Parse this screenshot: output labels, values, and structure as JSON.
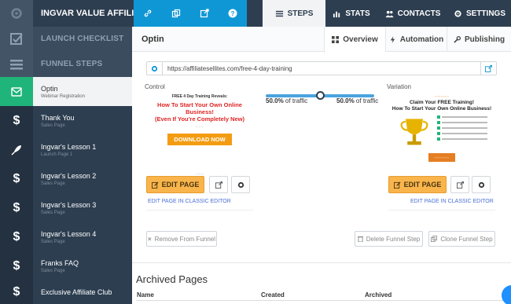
{
  "topbar": {
    "funnel_title": "INGVAR VALUE AFFILIAT...",
    "tabs": [
      {
        "label": "STEPS",
        "icon": "menu-icon"
      },
      {
        "label": "STATS",
        "icon": "bar-chart-icon"
      },
      {
        "label": "CONTACTS",
        "icon": "users-icon"
      },
      {
        "label": "SETTINGS",
        "icon": "gear-icon"
      }
    ],
    "active_tab": "STEPS"
  },
  "sidebar": {
    "launch_checklist": "LAUNCH CHECKLIST",
    "funnel_steps": "FUNNEL STEPS",
    "steps": [
      {
        "title": "Optin",
        "subtitle": "Webinar Registration",
        "icon": "envelope-icon",
        "active": true
      },
      {
        "title": "Thank You",
        "subtitle": "Sales Page",
        "icon": "dollar-icon"
      },
      {
        "title": "Ingvar's Lesson 1",
        "subtitle": "Launch Page 1",
        "icon": "rocket-icon"
      },
      {
        "title": "Ingvar's Lesson 2",
        "subtitle": "Sales Page",
        "icon": "dollar-icon"
      },
      {
        "title": "Ingvar's Lesson 3",
        "subtitle": "Sales Page",
        "icon": "dollar-icon"
      },
      {
        "title": "Ingvar's Lesson 4",
        "subtitle": "Sales Page",
        "icon": "dollar-icon"
      },
      {
        "title": "Franks FAQ",
        "subtitle": "Sales Page",
        "icon": "dollar-icon"
      },
      {
        "title": "Exclusive Affiliate Club",
        "subtitle": "",
        "icon": "dollar-icon"
      }
    ]
  },
  "main": {
    "page_name": "Optin",
    "tabs": [
      {
        "label": "Overview",
        "icon": "grid-icon"
      },
      {
        "label": "Automation",
        "icon": "bolt-icon"
      },
      {
        "label": "Publishing",
        "icon": "wrench-icon"
      }
    ],
    "url": "https://affiliatesellites.com/free-4-day-training",
    "control_label": "Control",
    "variation_label": "Variation",
    "traffic_left_value": "50.0%",
    "traffic_right_value": "50.0%",
    "traffic_suffix": "of traffic",
    "traffic_split": 0.5,
    "control_preview": {
      "small": "FREE 4 Day Training Reveals:",
      "headline_1": "How To Start Your Own Online Business!",
      "headline_2": "(Even If You're Completely New)",
      "button": "DOWNLOAD NOW"
    },
    "variation_preview": {
      "headline_1": "Claim Your FREE Training!",
      "headline_2": "How To Start Your Own Online Business!"
    },
    "edit_page": "EDIT PAGE",
    "classic_editor": "EDIT PAGE IN CLASSIC EDITOR",
    "remove_from_funnel": "Remove From Funnel",
    "delete_step": "Delete Funnel Step",
    "clone_step": "Clone Funnel Step",
    "archived_title": "Archived Pages",
    "archived_columns": [
      "Name",
      "Created",
      "Archived"
    ]
  },
  "colors": {
    "sidebar_bg": "#2d3e50",
    "accent_blue": "#0f97d5",
    "active_green": "#1fb57a",
    "edit_orange": "#f9b54c"
  }
}
